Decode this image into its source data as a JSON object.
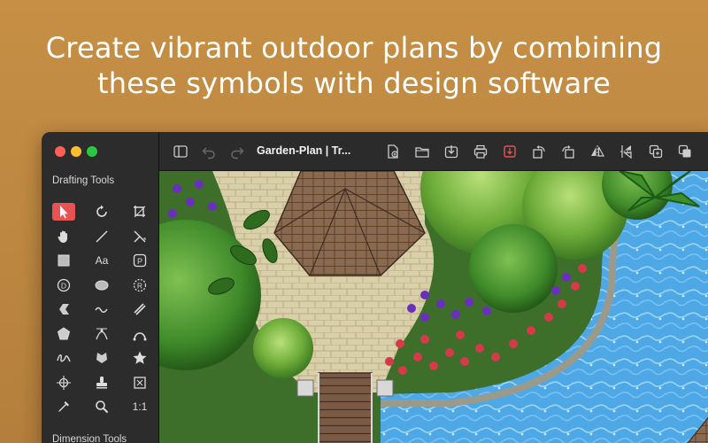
{
  "headline": {
    "line1": "Create vibrant outdoor plans by combining",
    "line2": "these symbols with design software"
  },
  "window": {
    "traffic_lights": [
      "close",
      "minimize",
      "zoom"
    ],
    "document_title": "Garden-Plan | Tr...",
    "accent_color": "#e65353"
  },
  "sidebar": {
    "drafting_title": "Drafting Tools",
    "dimension_title": "Dimension Tools",
    "tools": [
      {
        "name": "arrow-select-icon",
        "active": true
      },
      {
        "name": "rotate-icon"
      },
      {
        "name": "crop-icon"
      },
      {
        "name": "hand-pan-icon"
      },
      {
        "name": "line-icon"
      },
      {
        "name": "trim-line-icon"
      },
      {
        "name": "rectangle-icon"
      },
      {
        "name": "text-tool-icon",
        "label": "Aa"
      },
      {
        "name": "parking-symbol-icon",
        "label": "P"
      },
      {
        "name": "circle-d-icon",
        "label": "D"
      },
      {
        "name": "ellipse-icon"
      },
      {
        "name": "circle-r-icon",
        "label": "R"
      },
      {
        "name": "chevron-shape-icon"
      },
      {
        "name": "wave-line-icon"
      },
      {
        "name": "parallel-lines-icon"
      },
      {
        "name": "polygon-icon"
      },
      {
        "name": "bezier-icon"
      },
      {
        "name": "arc-icon"
      },
      {
        "name": "freehand-icon"
      },
      {
        "name": "fill-shape-icon"
      },
      {
        "name": "star-icon"
      },
      {
        "name": "crosshair-icon"
      },
      {
        "name": "stamp-icon"
      },
      {
        "name": "frame-icon"
      },
      {
        "name": "eyedropper-icon"
      },
      {
        "name": "magnifier-icon"
      },
      {
        "name": "actual-size-icon",
        "label": "1:1"
      }
    ]
  },
  "toolbar": {
    "buttons": [
      "sidebar-toggle-icon",
      "undo-icon",
      "redo-icon",
      "new-document-icon",
      "folder-icon",
      "download-icon",
      "print-icon",
      "snap-icon",
      "rotate-left-icon",
      "rotate-right-icon",
      "flip-horizontal-icon",
      "flip-vertical-icon",
      "group-icon",
      "ungroup-icon"
    ]
  }
}
